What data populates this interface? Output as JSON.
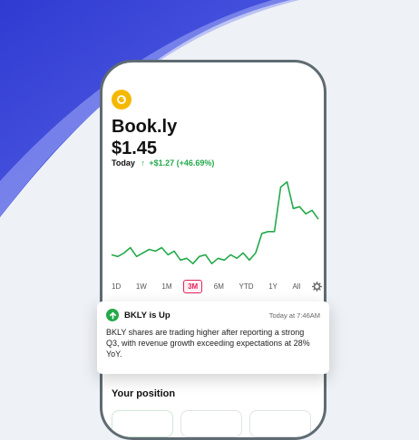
{
  "app": {
    "stock_name": "Book.ly",
    "price": "$1.45",
    "today_label": "Today",
    "change": "+$1.27 (+46.69%)"
  },
  "ranges": [
    "1D",
    "1W",
    "1M",
    "3M",
    "6M",
    "YTD",
    "1Y",
    "All"
  ],
  "selected_range": "3M",
  "notification": {
    "title": "BKLY is Up",
    "time": "Today at 7:46AM",
    "body": "BKLY shares are trading higher after reporting a strong Q3, with revenue growth exceeding expectations at 28% YoY."
  },
  "position": {
    "title": "Your position"
  },
  "colors": {
    "accent_green": "#23a94a",
    "selected_pink": "#e0245e",
    "logo_yellow": "#f5b800"
  },
  "chart_data": {
    "type": "line",
    "series": [
      {
        "values": [
          1.25,
          1.24,
          1.26,
          1.29,
          1.24,
          1.26,
          1.28,
          1.27,
          1.29,
          1.25,
          1.27,
          1.22,
          1.23,
          1.2,
          1.24,
          1.25,
          1.2,
          1.23,
          1.22,
          1.25,
          1.23,
          1.26,
          1.22,
          1.26,
          1.37,
          1.38,
          1.38,
          1.63,
          1.66,
          1.51,
          1.52,
          1.48,
          1.5,
          1.45
        ]
      }
    ]
  }
}
